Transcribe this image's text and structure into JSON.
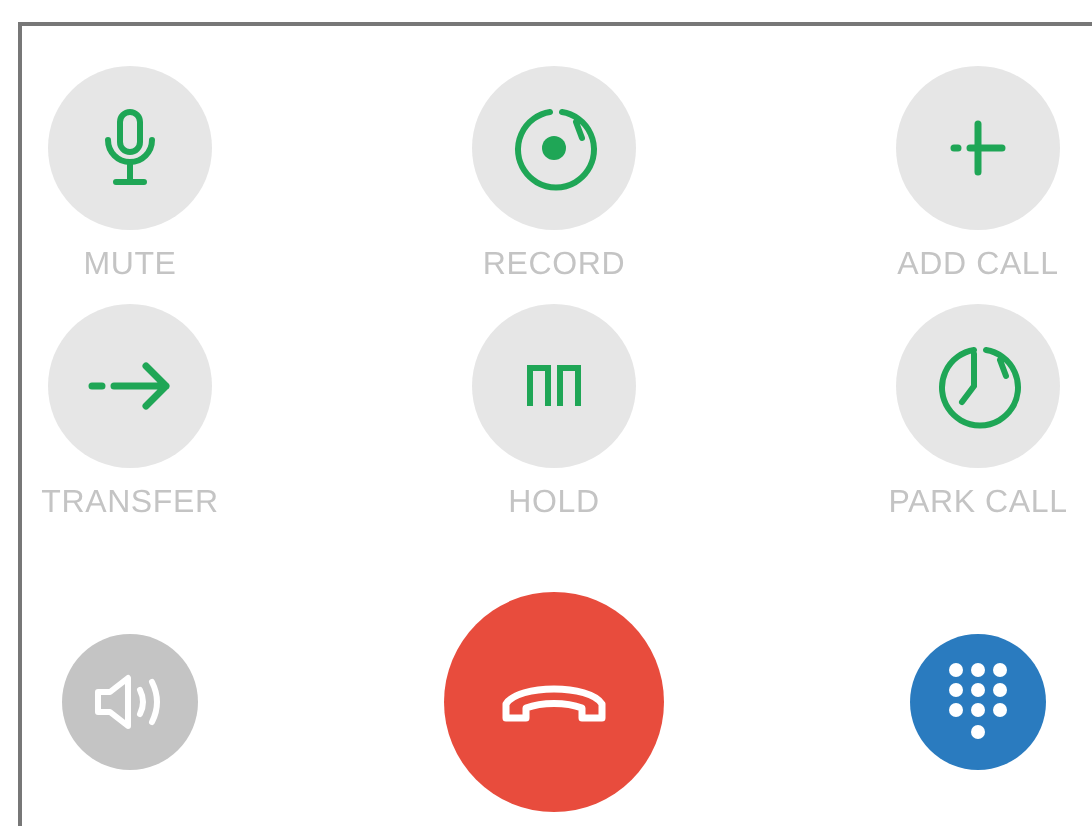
{
  "call_actions": [
    {
      "kind": "mute",
      "label": "MUTE"
    },
    {
      "kind": "record",
      "label": "RECORD"
    },
    {
      "kind": "add",
      "label": "ADD CALL"
    },
    {
      "kind": "transfer",
      "label": "TRANSFER"
    },
    {
      "kind": "hold",
      "label": "HOLD"
    },
    {
      "kind": "park",
      "label": "PARK CALL"
    }
  ],
  "bottom_controls": [
    {
      "kind": "speaker"
    },
    {
      "kind": "end_call"
    },
    {
      "kind": "keypad"
    }
  ]
}
